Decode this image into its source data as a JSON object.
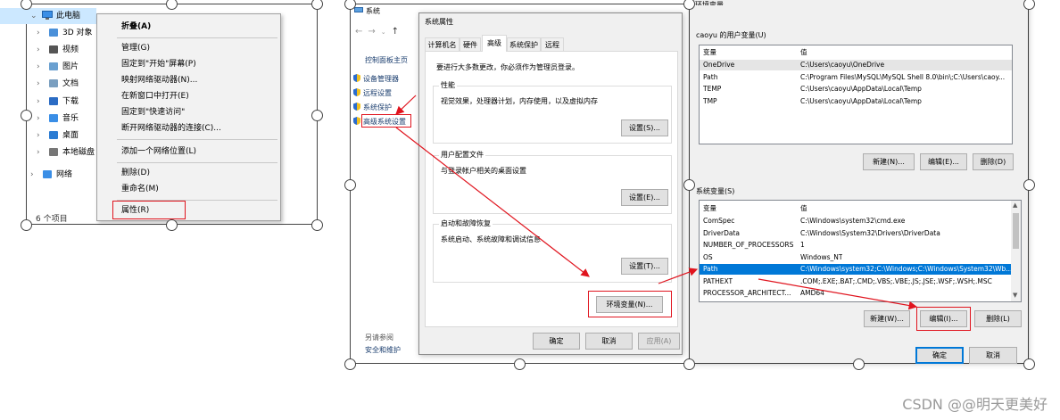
{
  "explorer": {
    "root_label": "此电脑",
    "tree_items": [
      {
        "label": "3D 对象",
        "icon": "cube-3d-icon"
      },
      {
        "label": "视频",
        "icon": "video-icon"
      },
      {
        "label": "图片",
        "icon": "picture-icon"
      },
      {
        "label": "文档",
        "icon": "document-icon"
      },
      {
        "label": "下载",
        "icon": "download-icon"
      },
      {
        "label": "音乐",
        "icon": "music-icon"
      },
      {
        "label": "桌面",
        "icon": "desktop-icon"
      },
      {
        "label": "本地磁盘",
        "icon": "disk-icon"
      },
      {
        "label": "网络",
        "icon": "network-icon"
      }
    ],
    "status": "6 个项目"
  },
  "context_menu": {
    "items": [
      {
        "label": "折叠(A)",
        "bold": true
      },
      {
        "label": "管理(G)"
      },
      {
        "label": "固定到\"开始\"屏幕(P)"
      },
      {
        "label": "映射网络驱动器(N)..."
      },
      {
        "label": "在新窗口中打开(E)"
      },
      {
        "label": "固定到\"快速访问\""
      },
      {
        "label": "断开网络驱动器的连接(C)..."
      },
      {
        "label": "添加一个网络位置(L)"
      },
      {
        "label": "删除(D)"
      },
      {
        "label": "重命名(M)"
      },
      {
        "label": "属性(R)"
      }
    ]
  },
  "system_window": {
    "title": "系统",
    "nav_home": "控制面板主页",
    "links": [
      "设备管理器",
      "远程设置",
      "系统保护",
      "高级系统设置"
    ],
    "see_also": "另请参阅",
    "security": "安全和维护"
  },
  "sysprops": {
    "title": "系统属性",
    "tabs": [
      "计算机名",
      "硬件",
      "高级",
      "系统保护",
      "远程"
    ],
    "admin_note": "要进行大多数更改，你必须作为管理员登录。",
    "perf_label": "性能",
    "perf_desc": "视觉效果，处理器计划，内存使用，以及虚拟内存",
    "profile_label": "用户配置文件",
    "profile_desc": "与登录帐户相关的桌面设置",
    "startup_label": "启动和故障恢复",
    "startup_desc": "系统启动、系统故障和调试信息",
    "settings_btn": "设置(S)...",
    "settings_e_btn": "设置(E)...",
    "settings_t_btn": "设置(T)...",
    "env_btn": "环境变量(N)...",
    "ok": "确定",
    "cancel": "取消",
    "apply": "应用(A)"
  },
  "envvars": {
    "title": "环境变量",
    "user_section": "caoyu 的用户变量(U)",
    "col_var": "变量",
    "col_val": "值",
    "user_vars": [
      {
        "name": "OneDrive",
        "value": "C:\\Users\\caoyu\\OneDrive"
      },
      {
        "name": "Path",
        "value": "C:\\Program Files\\MySQL\\MySQL Shell 8.0\\bin\\;C:\\Users\\caoy..."
      },
      {
        "name": "TEMP",
        "value": "C:\\Users\\caoyu\\AppData\\Local\\Temp"
      },
      {
        "name": "TMP",
        "value": "C:\\Users\\caoyu\\AppData\\Local\\Temp"
      }
    ],
    "user_new": "新建(N)...",
    "user_edit": "编辑(E)...",
    "user_delete": "删除(D)",
    "sys_section": "系统变量(S)",
    "sys_vars": [
      {
        "name": "ComSpec",
        "value": "C:\\Windows\\system32\\cmd.exe"
      },
      {
        "name": "DriverData",
        "value": "C:\\Windows\\System32\\Drivers\\DriverData"
      },
      {
        "name": "NUMBER_OF_PROCESSORS",
        "value": "1"
      },
      {
        "name": "OS",
        "value": "Windows_NT"
      },
      {
        "name": "Path",
        "value": "C:\\Windows\\system32;C:\\Windows;C:\\Windows\\System32\\Wb..."
      },
      {
        "name": "PATHEXT",
        "value": ".COM;.EXE;.BAT;.CMD;.VBS;.VBE;.JS;.JSE;.WSF;.WSH;.MSC"
      },
      {
        "name": "PROCESSOR_ARCHITECT...",
        "value": "AMD64"
      }
    ],
    "sys_new": "新建(W)...",
    "sys_edit": "编辑(I)...",
    "sys_delete": "删除(L)",
    "ok": "确定",
    "cancel": "取消"
  },
  "watermark": "CSDN @@明天更美好",
  "colors": {
    "highlight": "#0078d7",
    "annotation_red": "#e0141e"
  }
}
